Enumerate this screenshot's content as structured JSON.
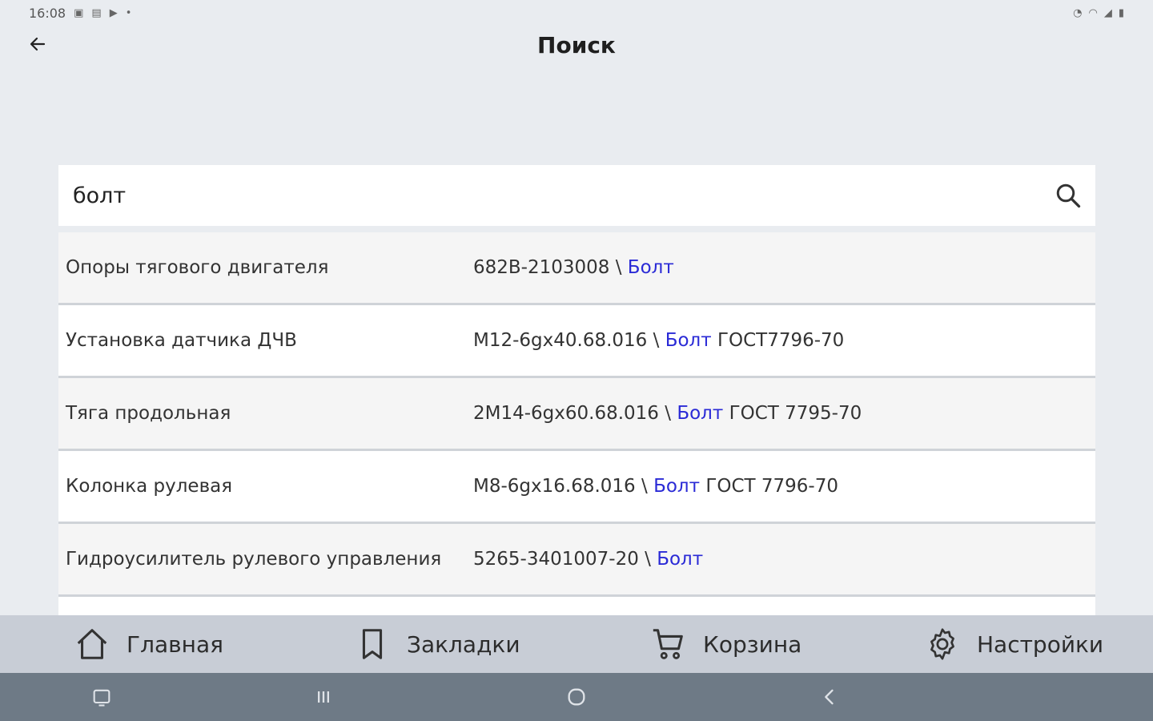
{
  "status_bar": {
    "time": "16:08"
  },
  "app_bar": {
    "title": "Поиск"
  },
  "search": {
    "value": "болт",
    "placeholder": ""
  },
  "results": [
    {
      "section": "Опоры тягового двигателя",
      "code": "682B-2103008 \\ ",
      "match": "Болт",
      "suffix": ""
    },
    {
      "section": "Установка датчика ДЧВ",
      "code": "M12-6gx40.68.016 \\ ",
      "match": "Болт",
      "suffix": " ГОСТ7796-70"
    },
    {
      "section": "Тяга продольная",
      "code": "2M14-6gx60.68.016 \\ ",
      "match": "Болт",
      "suffix": " ГОСТ 7795-70"
    },
    {
      "section": "Колонка рулевая",
      "code": "M8-6gx16.68.016 \\ ",
      "match": "Болт",
      "suffix": " ГОСТ 7796-70"
    },
    {
      "section": "Гидроусилитель рулевого управления",
      "code": "5265-3401007-20 \\ ",
      "match": "Болт",
      "suffix": ""
    }
  ],
  "bottom_nav": {
    "home": "Главная",
    "bookmarks": "Закладки",
    "cart": "Корзина",
    "settings": "Настройки"
  },
  "colors": {
    "highlight": "#2a2ad6",
    "background": "#e9ecf0",
    "bottom_nav": "#c8cdd6",
    "system_nav": "#6e7a86"
  },
  "icons": {
    "back": "arrow-left-icon",
    "search": "search-icon",
    "home": "home-icon",
    "bookmarks": "bookmark-icon",
    "cart": "cart-icon",
    "settings": "gear-icon"
  }
}
